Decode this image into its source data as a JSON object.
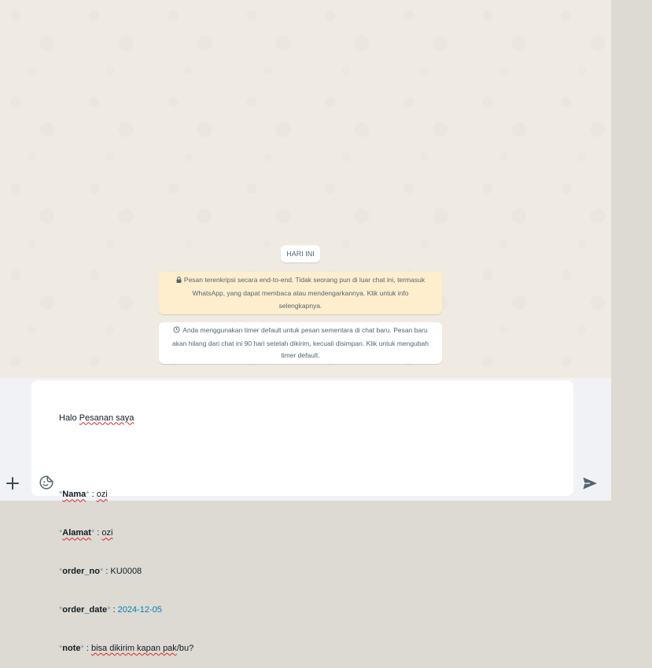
{
  "chat": {
    "date_chip": "HARI INI",
    "encryption_notice": "Pesan terenkripsi secara end-to-end. Tidak seorang pun di luar chat ini, termasuk WhatsApp, yang dapat membaca atau mendengarkannya. Klik untuk info selengkapnya.",
    "timer_notice": "Anda menggunakan timer default untuk pesan sementara di chat baru. Pesan baru akan hilang dari chat ini 90 hari setelah dikirim, kecuali disimpan. Klik untuk mengubah timer default."
  },
  "composer": {
    "greeting_word": "Halo",
    "greeting_rest": "Pesanan saya",
    "asterisk": "*",
    "fields": [
      {
        "label": "Nama",
        "value": "ozi"
      },
      {
        "label": "Alamat",
        "value": "ozi"
      },
      {
        "label": "order_no",
        "value": "KU0008"
      },
      {
        "label": "order_date",
        "value": "2024-12-05"
      },
      {
        "label": "note",
        "value_word": "bisa dikirim kapan pak",
        "value_rest": "/bu?"
      }
    ],
    "separator": " : "
  },
  "icons": {
    "plus": "plus-icon",
    "sticker": "sticker-icon",
    "send": "send-icon",
    "lock": "lock-icon",
    "timer": "timer-icon"
  },
  "colors": {
    "chat_background": "#efeae2",
    "footer_background": "#f0f2f5",
    "encryption_notice_bg": "#ffeecd",
    "link_blue": "#027eb5",
    "spellcheck_red": "#e02424"
  }
}
